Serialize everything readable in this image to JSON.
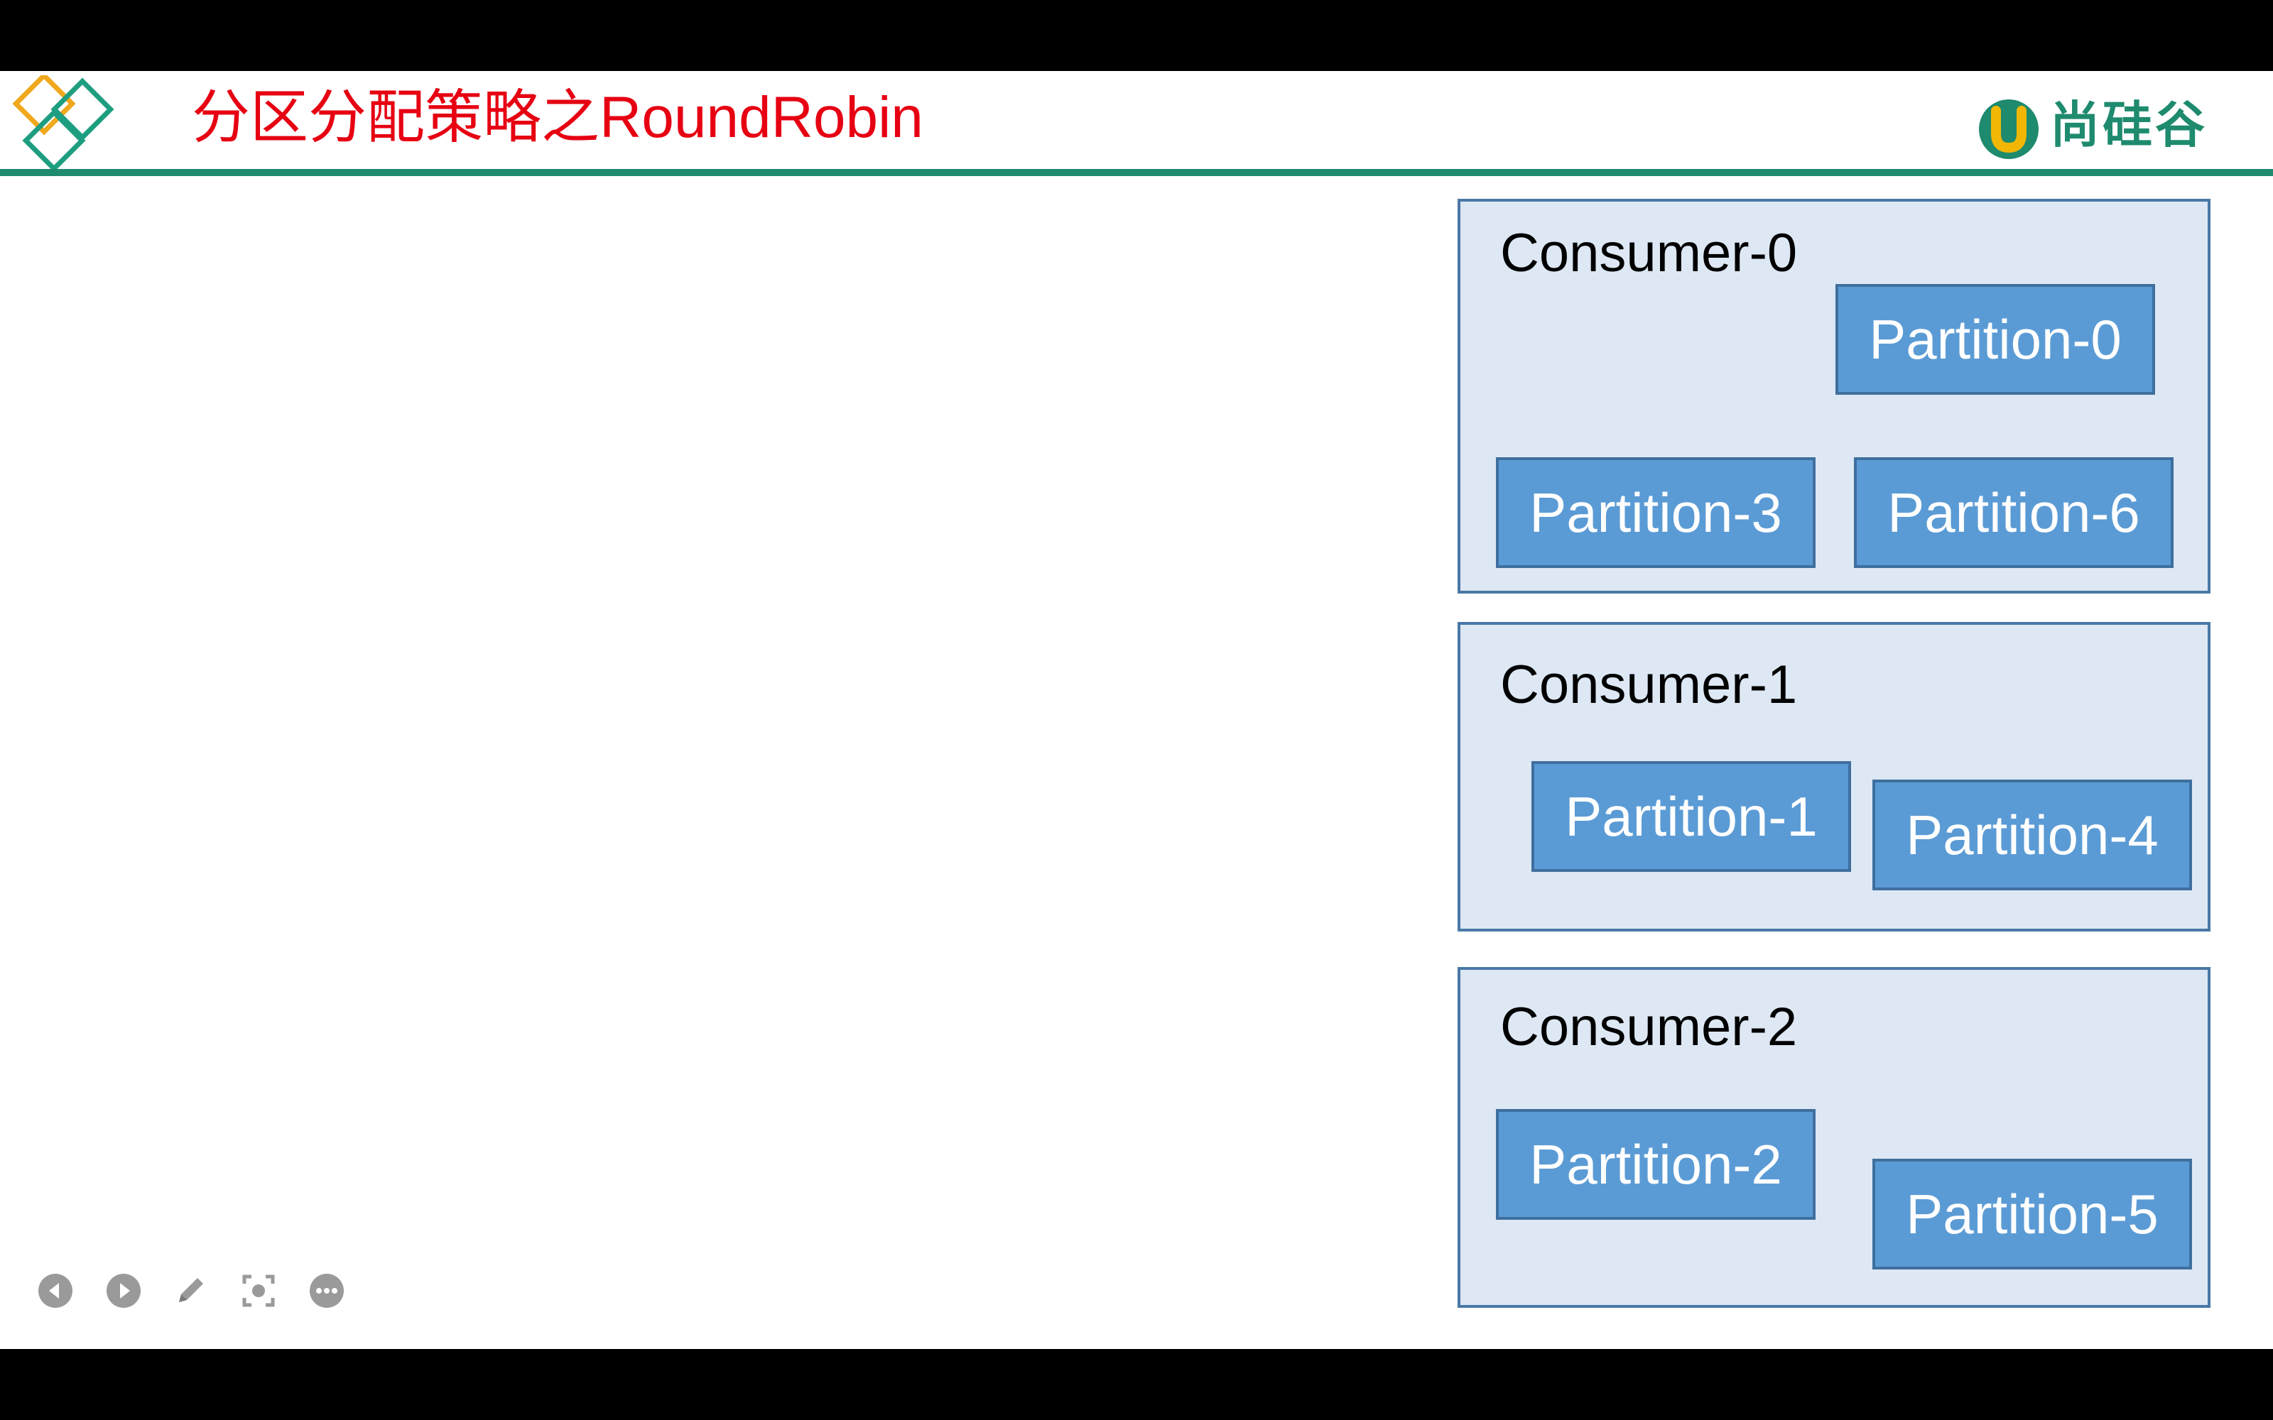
{
  "slide": {
    "title": "分区分配策略之RoundRobin",
    "brand_name": "尚硅谷",
    "brand_icon": "u-logo-icon",
    "logo_icon": "diamond-logo-icon",
    "accent_color": "#1e8a6e",
    "title_color": "#e60012"
  },
  "diagram": {
    "consumers": [
      {
        "label": "Consumer-0",
        "partitions": [
          "Partition-0",
          "Partition-3",
          "Partition-6"
        ]
      },
      {
        "label": "Consumer-1",
        "partitions": [
          "Partition-1",
          "Partition-4"
        ]
      },
      {
        "label": "Consumer-2",
        "partitions": [
          "Partition-2",
          "Partition-5"
        ]
      }
    ]
  },
  "controls": [
    {
      "name": "prev-slide-button",
      "icon": "arrow-left-icon"
    },
    {
      "name": "next-slide-button",
      "icon": "arrow-right-icon"
    },
    {
      "name": "pen-button",
      "icon": "pencil-icon"
    },
    {
      "name": "focus-button",
      "icon": "focus-icon"
    },
    {
      "name": "more-button",
      "icon": "more-icon"
    }
  ]
}
